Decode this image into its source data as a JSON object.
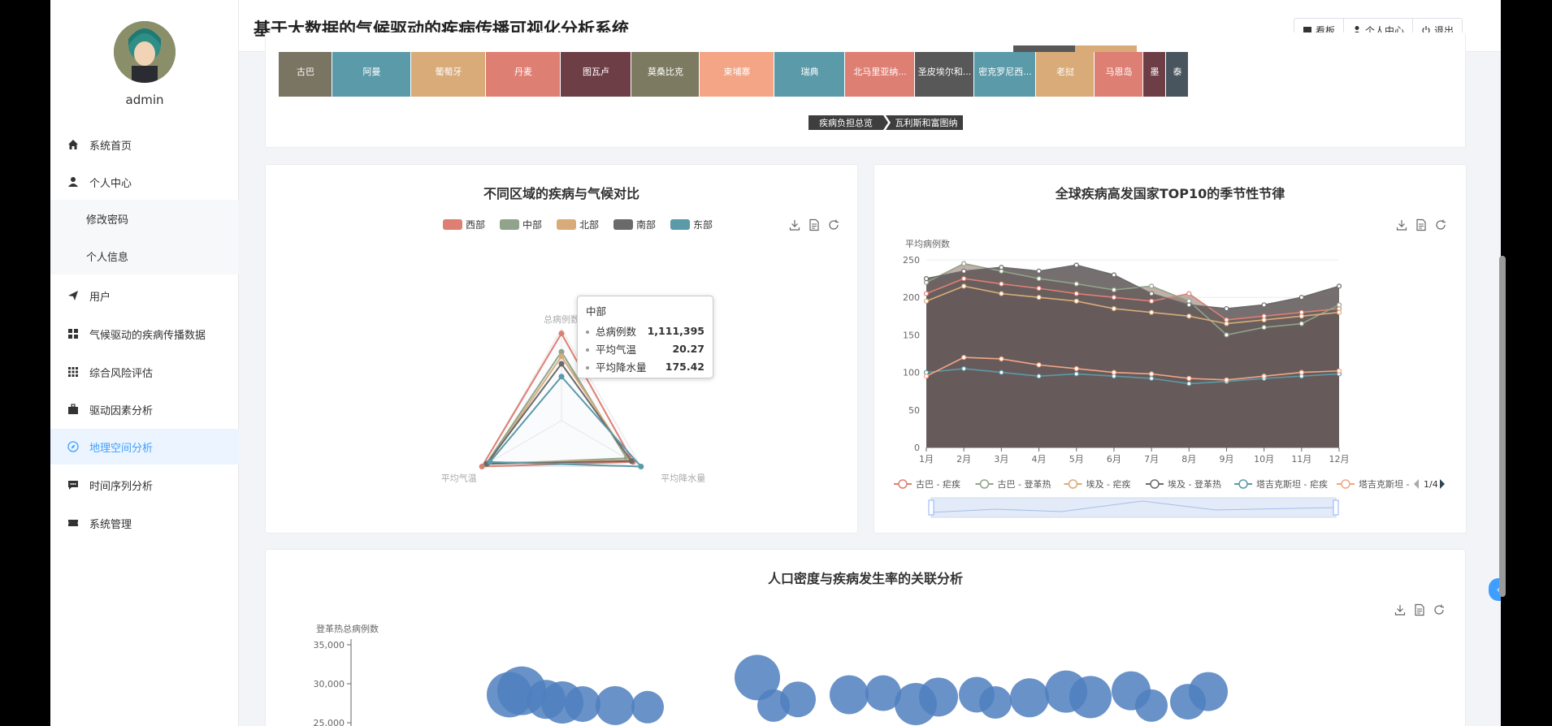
{
  "app": {
    "title": "基于大数据的气候驱动的疾病传播可视化分析系统"
  },
  "header": {
    "buttons": [
      {
        "label": "看板",
        "icon": "monitor-icon"
      },
      {
        "label": "个人中心",
        "icon": "user-icon"
      },
      {
        "label": "退出",
        "icon": "power-icon"
      }
    ]
  },
  "user": {
    "name": "admin"
  },
  "sidebar": {
    "items": [
      {
        "label": "系统首页",
        "icon": "home-icon"
      },
      {
        "label": "个人中心",
        "icon": "user-icon"
      },
      {
        "label": "修改密码",
        "sub": true
      },
      {
        "label": "个人信息",
        "sub": true
      },
      {
        "label": "用户",
        "icon": "send-icon"
      },
      {
        "label": "气候驱动的疾病传播数据",
        "icon": "grid-icon"
      },
      {
        "label": "综合风险评估",
        "icon": "apps-icon"
      },
      {
        "label": "驱动因素分析",
        "icon": "briefcase-icon"
      },
      {
        "label": "地理空间分析",
        "icon": "compass-icon",
        "active": true
      },
      {
        "label": "时间序列分析",
        "icon": "chat-icon"
      },
      {
        "label": "系统管理",
        "icon": "ticket-icon"
      }
    ]
  },
  "treemap": {
    "cells": [
      {
        "label": "古巴",
        "color": "#7a7462"
      },
      {
        "label": "阿曼",
        "color": "#5b9aa8"
      },
      {
        "label": "葡萄牙",
        "color": "#d9ab79"
      },
      {
        "label": "丹麦",
        "color": "#de7f74"
      },
      {
        "label": "图瓦卢",
        "color": "#6e3e46"
      },
      {
        "label": "莫桑比克",
        "color": "#7c7a60"
      },
      {
        "label": "柬埔寨",
        "color": "#f3a585"
      },
      {
        "label": "瑞典",
        "color": "#5b9aa8"
      },
      {
        "label": "北马里亚纳...",
        "color": "#de7f74"
      },
      {
        "label": "圣皮埃尔和...",
        "color": "#585858"
      },
      {
        "label": "密克罗尼西...",
        "color": "#5b9aa8"
      },
      {
        "label": "老挝",
        "color": "#d9ab79"
      },
      {
        "label": "马恩岛",
        "color": "#de7f74"
      },
      {
        "label": "墨",
        "color": "#6e3e46"
      },
      {
        "label": "泰",
        "color": "#48555e"
      }
    ],
    "breadcrumb": [
      "疾病负担总览",
      "瓦利斯和富图纳"
    ]
  },
  "radar": {
    "title": "不同区域的疾病与气候对比",
    "legend": [
      {
        "name": "西部",
        "color": "#de7f74"
      },
      {
        "name": "中部",
        "color": "#91a38a"
      },
      {
        "name": "北部",
        "color": "#d9ab79"
      },
      {
        "name": "南部",
        "color": "#6a6a6a"
      },
      {
        "name": "东部",
        "color": "#5b9aa8"
      }
    ],
    "indicators": [
      "总病例数",
      "平均气温",
      "平均降水量"
    ],
    "tooltip": {
      "title": "中部",
      "rows": [
        {
          "label": "总病例数",
          "value": "1,111,395"
        },
        {
          "label": "平均气温",
          "value": "20.27"
        },
        {
          "label": "平均降水量",
          "value": "175.42"
        }
      ]
    }
  },
  "seasonal": {
    "title": "全球疾病高发国家TOP10的季节性节律",
    "ylabel": "平均病例数",
    "yticks": [
      "250",
      "200",
      "150",
      "100",
      "50",
      "0"
    ],
    "xticks": [
      "1月",
      "2月",
      "3月",
      "4月",
      "5月",
      "6月",
      "7月",
      "8月",
      "9月",
      "10月",
      "11月",
      "12月"
    ],
    "legend": [
      {
        "name": "古巴 - 疟疾",
        "color": "#de7f74"
      },
      {
        "name": "古巴 - 登革热",
        "color": "#91a38a"
      },
      {
        "name": "埃及 - 疟疾",
        "color": "#d9ab79"
      },
      {
        "name": "埃及 - 登革热",
        "color": "#6a6a6a"
      },
      {
        "name": "塔吉克斯坦 - 疟疾",
        "color": "#5b9aa8"
      },
      {
        "name": "塔吉克斯坦 -",
        "color": "#f3a585"
      }
    ],
    "page": "1/4"
  },
  "bubble": {
    "title": "人口密度与疾病发生率的关联分析",
    "ylabel": "登革热总病例数",
    "yticks": [
      "35,000",
      "30,000",
      "25,000"
    ]
  },
  "chart_data": [
    {
      "type": "radar",
      "title": "不同区域的疾病与气候对比",
      "indicators": [
        "总病例数",
        "平均气温",
        "平均降水量"
      ],
      "series": [
        {
          "name": "西部",
          "values": [
            0.95,
            1.0,
            0.9
          ]
        },
        {
          "name": "中部",
          "values": [
            0.75,
            0.95,
            0.82
          ]
        },
        {
          "name": "北部",
          "values": [
            0.7,
            0.92,
            0.86
          ]
        },
        {
          "name": "南部",
          "values": [
            0.62,
            0.94,
            0.88
          ]
        },
        {
          "name": "东部",
          "values": [
            0.48,
            0.9,
            1.0
          ]
        }
      ]
    },
    {
      "type": "area",
      "title": "全球疾病高发国家TOP10的季节性节律",
      "x": [
        "1月",
        "2月",
        "3月",
        "4月",
        "5月",
        "6月",
        "7月",
        "8月",
        "9月",
        "10月",
        "11月",
        "12月"
      ],
      "ylabel": "平均病例数",
      "ylim": [
        0,
        250
      ],
      "series": [
        {
          "name": "古巴 - 疟疾",
          "values": [
            205,
            225,
            218,
            212,
            205,
            200,
            195,
            205,
            170,
            175,
            180,
            185
          ]
        },
        {
          "name": "古巴 - 登革热",
          "values": [
            220,
            245,
            235,
            225,
            218,
            210,
            215,
            195,
            150,
            160,
            165,
            190
          ]
        },
        {
          "name": "埃及 - 疟疾",
          "values": [
            195,
            215,
            205,
            200,
            195,
            185,
            180,
            175,
            165,
            170,
            175,
            180
          ]
        },
        {
          "name": "埃及 - 登革热",
          "values": [
            225,
            235,
            240,
            235,
            243,
            230,
            205,
            190,
            185,
            190,
            200,
            215
          ]
        },
        {
          "name": "塔吉克斯坦 - 疟疾",
          "values": [
            100,
            105,
            100,
            95,
            98,
            95,
            92,
            85,
            88,
            92,
            95,
            98
          ]
        },
        {
          "name": "塔吉克斯坦 -",
          "values": [
            95,
            120,
            118,
            110,
            105,
            100,
            98,
            92,
            90,
            95,
            100,
            102
          ]
        }
      ]
    },
    {
      "type": "scatter",
      "title": "人口密度与疾病发生率的关联分析",
      "ylabel": "登革热总病例数",
      "ylim": [
        25000,
        35000
      ],
      "points": [
        [
          1,
          28600,
          28
        ],
        [
          2,
          29100,
          30
        ],
        [
          3,
          28000,
          24
        ],
        [
          4,
          27600,
          26
        ],
        [
          5,
          27400,
          22
        ],
        [
          6,
          27200,
          24
        ],
        [
          7,
          27000,
          20
        ],
        [
          8,
          30800,
          28
        ],
        [
          9,
          27200,
          20
        ],
        [
          10,
          28000,
          22
        ],
        [
          11,
          28600,
          24
        ],
        [
          12,
          28800,
          22
        ],
        [
          13,
          27400,
          26
        ],
        [
          14,
          28300,
          24
        ],
        [
          15,
          28600,
          22
        ],
        [
          16,
          27600,
          20
        ],
        [
          17,
          28200,
          24
        ],
        [
          18,
          29000,
          26
        ],
        [
          19,
          28300,
          26
        ],
        [
          20,
          29100,
          24
        ],
        [
          21,
          27200,
          20
        ],
        [
          22,
          27700,
          22
        ],
        [
          23,
          29000,
          24
        ]
      ]
    }
  ]
}
